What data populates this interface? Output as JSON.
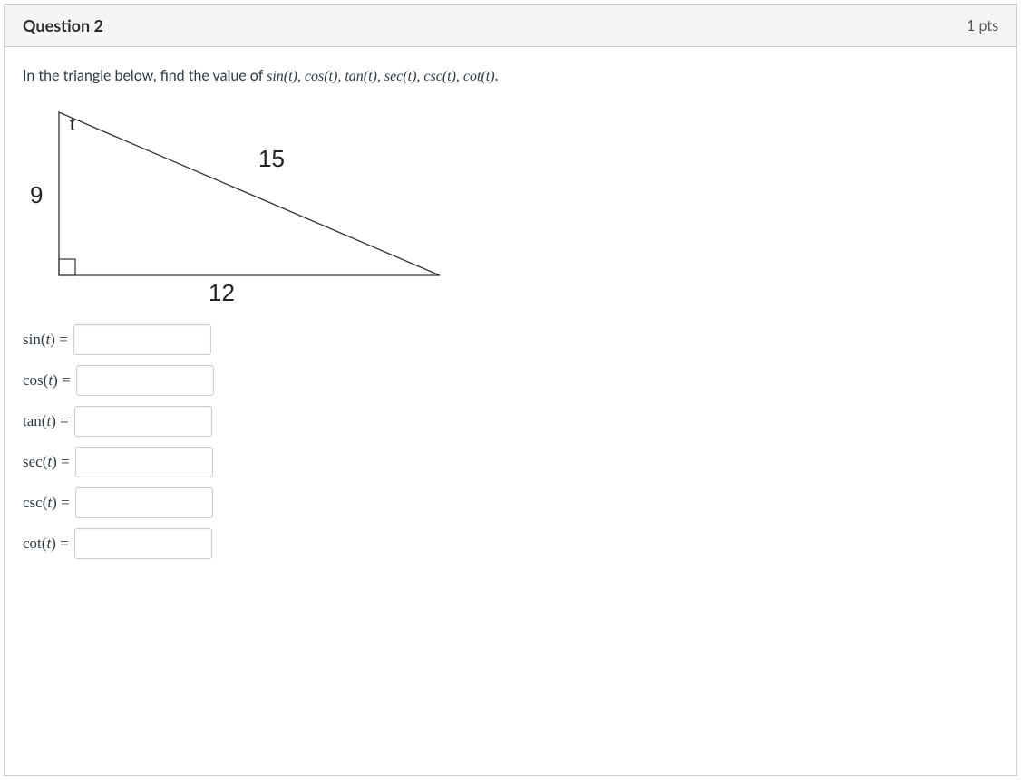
{
  "header": {
    "title": "Question 2",
    "points": "1 pts"
  },
  "prompt": {
    "prefix": "In the triangle below, find the value of ",
    "funcs": "sin(t), cos(t), tan(t), sec(t), csc(t), cot(t)",
    "suffix": "."
  },
  "triangle": {
    "angle_label": "t",
    "side_vertical": "9",
    "side_hypotenuse": "15",
    "side_base": "12"
  },
  "answers": [
    {
      "label_fn": "sin",
      "label_arg": "t"
    },
    {
      "label_fn": "cos",
      "label_arg": "t"
    },
    {
      "label_fn": "tan",
      "label_arg": "t"
    },
    {
      "label_fn": "sec",
      "label_arg": "t"
    },
    {
      "label_fn": "csc",
      "label_arg": "t"
    },
    {
      "label_fn": "cot",
      "label_arg": "t"
    }
  ]
}
